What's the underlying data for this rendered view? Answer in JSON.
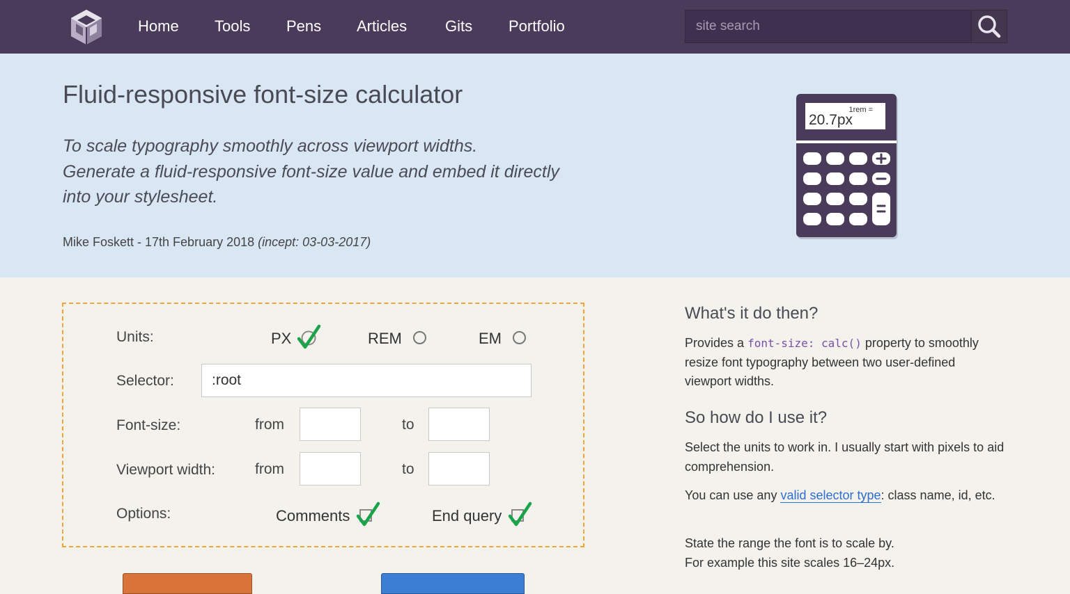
{
  "nav": {
    "items": [
      "Home",
      "Tools",
      "Pens",
      "Articles",
      "Gits",
      "Portfolio"
    ],
    "search_placeholder": "site search"
  },
  "hero": {
    "title": "Fluid-responsive font-size calculator",
    "intro_lines": [
      "To scale typography smoothly across viewport widths.",
      "Generate a fluid-responsive font-size value and embed it directly",
      "into your stylesheet."
    ],
    "author_date": "Mike Foskett - 17th February 2018",
    "incept": "(incept: 03-03-2017)",
    "calc_label": "1rem =",
    "calc_value": "20.7px"
  },
  "form": {
    "units_label": "Units:",
    "unit_options": [
      "PX",
      "REM",
      "EM"
    ],
    "selected_unit": "PX",
    "selector_label": "Selector:",
    "selector_value": ":root",
    "font_size_label": "Font-size:",
    "viewport_label": "Viewport width:",
    "from_label": "from",
    "to_label": "to",
    "font_from_value": "",
    "font_to_value": "",
    "viewport_from_value": "",
    "viewport_to_value": "",
    "options_label": "Options:",
    "comments_label": "Comments",
    "end_query_label": "End query",
    "comments_checked": true,
    "end_query_checked": true
  },
  "side": {
    "h1": "What's it do then?",
    "p1_before": "Provides a",
    "p1_code": "font-size: calc()",
    "p1_after": "property to smoothly resize font typography between two user-defined viewport widths.",
    "h2": "So how do I use it?",
    "p2": "Select the units to work in. I usually start with pixels to aid comprehension.",
    "p3_before": "You can use any",
    "p3_link": "valid selector type",
    "p3_after": ": class name, id, etc.",
    "p4_line1": "State the range the font is to scale by.",
    "p4_line2": "For example this site scales 16–24px."
  },
  "colors": {
    "nav_bg": "#4b3b5b",
    "hero_bg": "#d9e6f4",
    "form_border": "#f0a534",
    "check_green": "#1aa34a",
    "button_orange": "#d8743a",
    "button_blue": "#3b7ed4"
  },
  "icons": {
    "logo": "hexagon-cube-logo",
    "search": "magnifier-icon",
    "calculator": "calculator-illustration",
    "check": "checkmark-icon"
  }
}
